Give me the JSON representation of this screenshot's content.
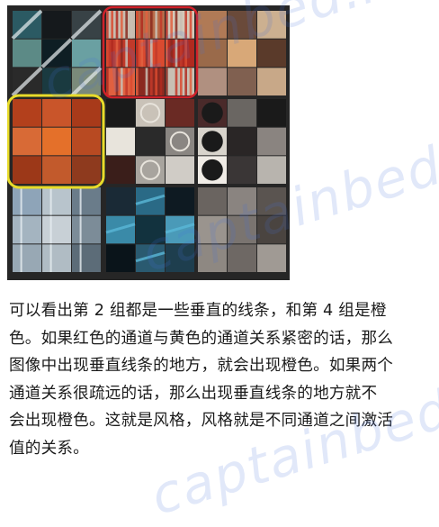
{
  "figure": {
    "highlight_colors": {
      "red_box": "#d0212a",
      "yellow_box": "#e8dc2a"
    },
    "palette": {
      "grid_line": "#1e1e1e",
      "orange": [
        "#b3401c",
        "#c9552a",
        "#a83a1a",
        "#d86a36",
        "#e4702a",
        "#b84a22",
        "#9c3818",
        "#c25a2c",
        "#8e3a1e"
      ],
      "red_stripes": [
        "#c23a2a",
        "#d94a30",
        "#b02a20",
        "#e06040",
        "#8a2a20",
        "#c8c0b4"
      ]
    }
  },
  "caption": {
    "lines": [
      "可以看出第 2 组都是一些垂直的线条，和第 4 组是橙",
      "色。如果红色的通道与黄色的通道关系紧密的话，那么",
      "图像中出现垂直线条的地方，就会出现橙色。如果两个",
      "通道关系很疏远的话，那么出现垂直线条的地方就不",
      "会出现橙色。这就是风格，风格就是不同通道之间激活",
      "值的关系。"
    ]
  },
  "watermark": {
    "text": "captainbed.net"
  }
}
